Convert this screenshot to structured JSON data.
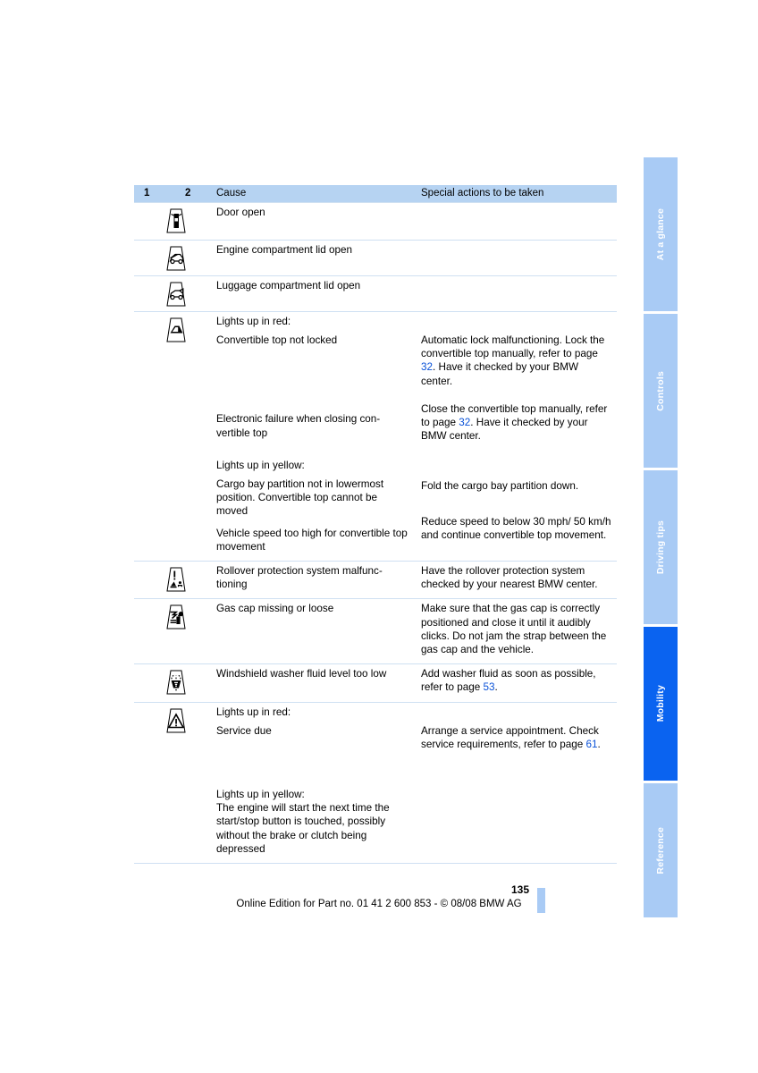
{
  "page": {
    "number": "135",
    "footer_note": "Online Edition for Part no. 01 41 2 600 853 - © 08/08 BMW AG"
  },
  "side_tabs": [
    {
      "label": "At a glance",
      "active": false
    },
    {
      "label": "Controls",
      "active": false
    },
    {
      "label": "Driving tips",
      "active": false
    },
    {
      "label": "Mobility",
      "active": true
    },
    {
      "label": "Reference",
      "active": false
    }
  ],
  "table": {
    "headers": {
      "col1": "1",
      "col2": "2",
      "cause": "Cause",
      "action": "Special actions to be taken"
    },
    "rows": [
      {
        "icon": "door-open-icon",
        "cause_blocks": [
          {
            "text": "Door open"
          }
        ],
        "action_blocks": []
      },
      {
        "icon": "engine-compartment-lid-open-icon",
        "cause_blocks": [
          {
            "text": "Engine compartment lid open"
          }
        ],
        "action_blocks": []
      },
      {
        "icon": "luggage-compartment-lid-open-icon",
        "cause_blocks": [
          {
            "text": "Luggage compartment lid open"
          }
        ],
        "action_blocks": []
      },
      {
        "icon": "convertible-top-icon",
        "cause_blocks": [
          {
            "text": "Lights up in red:"
          },
          {
            "text": "Convertible top not locked"
          },
          {
            "text": "Electronic failure when closing con-vertible top"
          },
          {
            "text": "Lights up in yellow:"
          },
          {
            "text": "Cargo bay partition not in lowermost position. Convertible top cannot be moved"
          },
          {
            "text": "Vehicle speed too high for convertible top movement"
          }
        ],
        "action_blocks": [
          {
            "text": "Automatic lock malfunctioning. Lock the convertible top manually, refer to page ",
            "ref": "32",
            "tail": ". Have it checked by your BMW center."
          },
          {
            "text": "Close the convertible top manually, refer to page ",
            "ref": "32",
            "tail": ". Have it checked by your BMW center."
          },
          {
            "text": "Fold the cargo bay partition down."
          },
          {
            "text": "Reduce speed to below 30 mph/ 50 km/h and continue convertible top movement."
          }
        ]
      },
      {
        "icon": "rollover-protection-icon",
        "cause_blocks": [
          {
            "text": "Rollover protection system malfunc-tioning"
          }
        ],
        "action_blocks": [
          {
            "text": "Have the rollover protection system checked by your nearest BMW center."
          }
        ]
      },
      {
        "icon": "gas-cap-icon",
        "cause_blocks": [
          {
            "text": "Gas cap missing or loose"
          }
        ],
        "action_blocks": [
          {
            "text": "Make sure that the gas cap is correctly positioned and close it until it audibly clicks. Do not jam the strap between the gas cap and the vehicle."
          }
        ]
      },
      {
        "icon": "washer-fluid-icon",
        "cause_blocks": [
          {
            "text": "Windshield washer fluid level too low"
          }
        ],
        "action_blocks": [
          {
            "text": "Add washer fluid as soon as possible, refer to page ",
            "ref": "53",
            "tail": "."
          }
        ]
      },
      {
        "icon": "service-warning-icon",
        "cause_blocks": [
          {
            "text": "Lights up in red:"
          },
          {
            "text": "Service due"
          },
          {
            "text": "Lights up in yellow:"
          },
          {
            "text": "The engine will start the next time the start/stop button is touched, possibly without the brake or clutch being depressed"
          }
        ],
        "action_blocks": [
          {
            "text": "Arrange a service appointment. Check service requirements, refer to page ",
            "ref": "61",
            "tail": "."
          }
        ]
      }
    ]
  },
  "colors": {
    "header_bg": "#b6d3f2",
    "tab_inactive": "#a9cbf5",
    "tab_active": "#0a63f0",
    "rule": "#cfe0f2",
    "link": "#0a52d8"
  }
}
